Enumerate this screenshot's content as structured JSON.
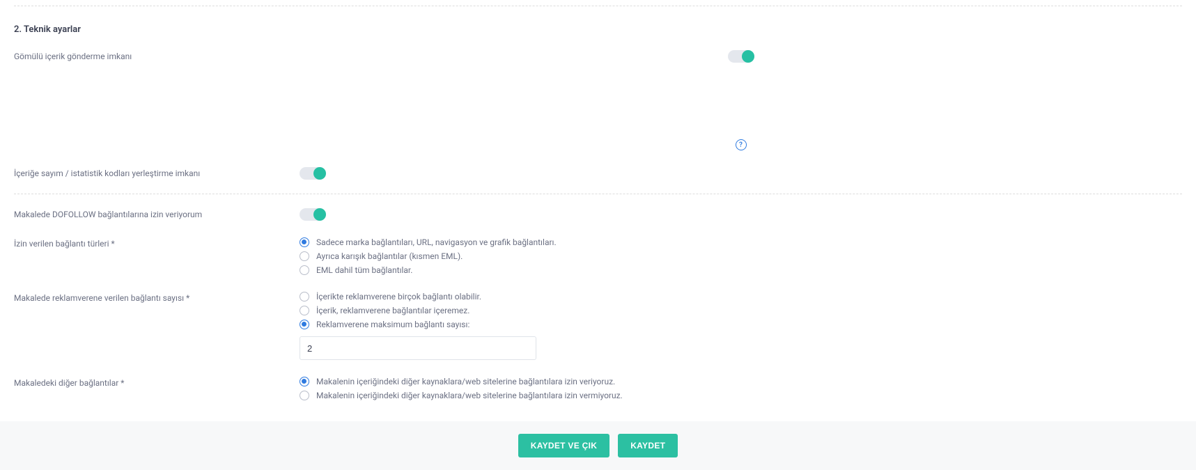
{
  "section": {
    "title": "2. Teknik ayarlar"
  },
  "toggles": {
    "embed": {
      "label": "Gömülü içerik gönderme imkanı"
    },
    "stats": {
      "label": "İçeriğe sayım / istatistik kodları yerleştirme imkanı"
    },
    "dofollow": {
      "label": "Makalede DOFOLLOW bağlantılarına izin veriyorum"
    }
  },
  "linkTypes": {
    "label": "İzin verilen bağlantı türleri *",
    "options": [
      "Sadece marka bağlantıları, URL, navigasyon ve grafik bağlantıları.",
      "Ayrıca karışık bağlantılar (kısmen EML).",
      "EML dahil tüm bağlantılar."
    ],
    "selected": 0
  },
  "linkCount": {
    "label": "Makalede reklamverene verilen bağlantı sayısı *",
    "options": [
      "İçerikte reklamverene birçok bağlantı olabilir.",
      "İçerik, reklamverene bağlantılar içeremez.",
      "Reklamverene maksimum bağlantı sayısı:"
    ],
    "selected": 2,
    "value": "2"
  },
  "otherLinks": {
    "label": "Makaledeki diğer bağlantılar *",
    "options": [
      "Makalenin içeriğindeki diğer kaynaklara/web sitelerine bağlantılara izin veriyoruz.",
      "Makalenin içeriğindeki diğer kaynaklara/web sitelerine bağlantılara izin vermiyoruz."
    ],
    "selected": 0
  },
  "footer": {
    "saveExit": "KAYDET VE ÇIK",
    "save": "KAYDET"
  }
}
